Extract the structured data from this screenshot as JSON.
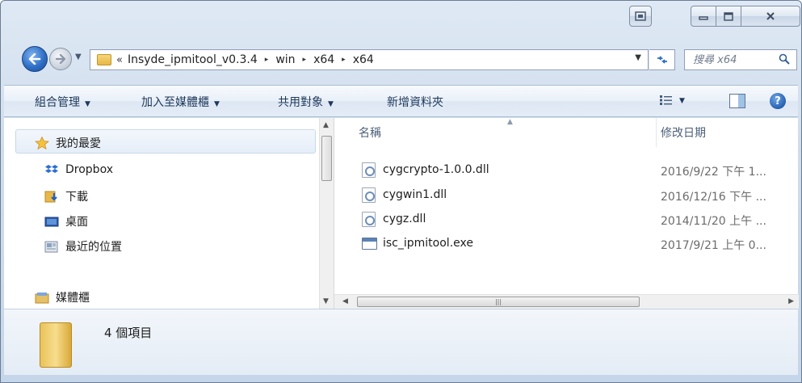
{
  "window": {
    "controls": {
      "minimize": "—",
      "maximize": "▫",
      "close": "✕"
    }
  },
  "address": {
    "overflow": "«",
    "crumbs": [
      "Insyde_ipmitool_v0.3.4",
      "win",
      "x64",
      "x64"
    ],
    "separator": "▸"
  },
  "search": {
    "placeholder": "搜尋 x64"
  },
  "toolbar": {
    "organize": "組合管理",
    "add_to_library": "加入至媒體櫃",
    "share_with": "共用對象",
    "new_folder": "新增資料夾"
  },
  "nav": {
    "favorites": "我的最愛",
    "items": [
      "Dropbox",
      "下載",
      "桌面",
      "最近的位置"
    ],
    "libraries": "媒體櫃"
  },
  "filelist": {
    "columns": {
      "name": "名稱",
      "modified": "修改日期"
    },
    "files": [
      {
        "name": "cygcrypto-1.0.0.dll",
        "date": "2016/9/22 下午 1...",
        "type": "dll"
      },
      {
        "name": "cygwin1.dll",
        "date": "2016/12/16 下午 ...",
        "type": "dll"
      },
      {
        "name": "cygz.dll",
        "date": "2014/11/20 上午 ...",
        "type": "dll"
      },
      {
        "name": "isc_ipmitool.exe",
        "date": "2017/9/21 上午 0...",
        "type": "exe"
      }
    ]
  },
  "details": {
    "item_count": "4 個項目"
  },
  "colors": {
    "accent": "#2f6fc6",
    "toolbar_text": "#1e395b",
    "column_header": "#4c607a"
  }
}
